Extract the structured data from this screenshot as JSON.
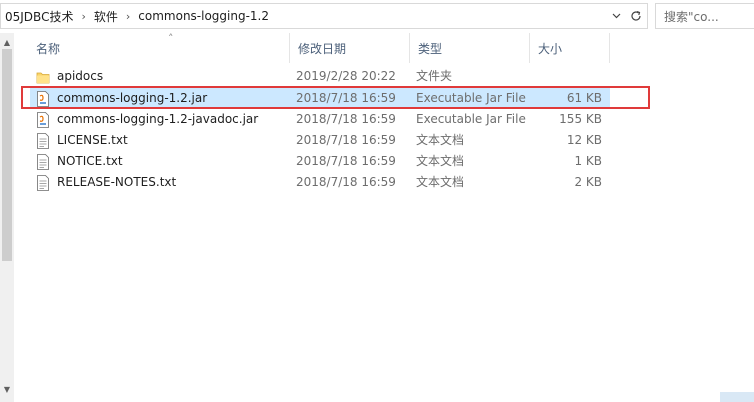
{
  "address": {
    "crumbs": [
      "05JDBC技术",
      "软件",
      "commons-logging-1.2"
    ]
  },
  "search": {
    "placeholder": "搜索\"co..."
  },
  "columns": {
    "name": "名称",
    "date": "修改日期",
    "type": "类型",
    "size": "大小"
  },
  "files": [
    {
      "name": "apidocs",
      "date": "2019/2/28 20:22",
      "type": "文件夹",
      "size": "",
      "icon": "folder-icon"
    },
    {
      "name": "commons-logging-1.2.jar",
      "date": "2018/7/18 16:59",
      "type": "Executable Jar File",
      "size": "61 KB",
      "icon": "jar-file-icon"
    },
    {
      "name": "commons-logging-1.2-javadoc.jar",
      "date": "2018/7/18 16:59",
      "type": "Executable Jar File",
      "size": "155 KB",
      "icon": "jar-file-icon"
    },
    {
      "name": "LICENSE.txt",
      "date": "2018/7/18 16:59",
      "type": "文本文档",
      "size": "12 KB",
      "icon": "text-file-icon"
    },
    {
      "name": "NOTICE.txt",
      "date": "2018/7/18 16:59",
      "type": "文本文档",
      "size": "1 KB",
      "icon": "text-file-icon"
    },
    {
      "name": "RELEASE-NOTES.txt",
      "date": "2018/7/18 16:59",
      "type": "文本文档",
      "size": "2 KB",
      "icon": "text-file-icon"
    }
  ],
  "colors": {
    "selected_row": "#cce8ff",
    "highlight_border": "#e03a3a",
    "header_text": "#4c607a"
  }
}
